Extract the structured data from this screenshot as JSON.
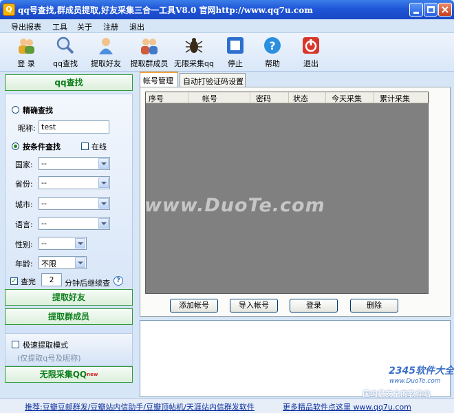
{
  "window": {
    "title": "qq号查找,群成员提取,好友采集三合一工具V8.0 官网http://www.qq7u.com"
  },
  "menu": [
    "导出报表",
    "工具",
    "关于",
    "注册",
    "退出"
  ],
  "toolbar": [
    {
      "label": "登 录",
      "icon": "users-login-icon"
    },
    {
      "label": "qq查找",
      "icon": "magnifier-icon"
    },
    {
      "label": "提取好友",
      "icon": "user-icon"
    },
    {
      "label": "提取群成员",
      "icon": "group-users-icon"
    },
    {
      "label": "无限采集qq",
      "icon": "bug-icon"
    },
    {
      "label": "停止",
      "icon": "stop-icon"
    },
    {
      "label": "帮助",
      "icon": "help-icon"
    },
    {
      "label": "退出",
      "icon": "power-icon"
    }
  ],
  "left": {
    "qq_search_button": "qq查找",
    "exact_search_label": "精确查找",
    "nickname_label": "昵称:",
    "nickname_value": "test",
    "condition_search_label": "按条件查找",
    "online_label": "在线",
    "fields": [
      {
        "label": "国家:",
        "value": "--"
      },
      {
        "label": "省份:",
        "value": "--"
      },
      {
        "label": "城市:",
        "value": "--"
      },
      {
        "label": "语言:",
        "value": "--"
      }
    ],
    "gender_label": "性别:",
    "gender_value": "--",
    "age_label": "年龄:",
    "age_value": "不限",
    "finish_check_label": "查完",
    "minutes_value": "2",
    "minutes_suffix": "分钟后继续查",
    "get_friends_button": "提取好友",
    "get_group_members_button": "提取群成员",
    "fast_mode_label": "极速提取模式",
    "fast_mode_hint": "(仅提取q号及昵称)",
    "unlimited_button": "无限采集QQ",
    "unlimited_badge": "new"
  },
  "tabs": [
    "帐号管理",
    "自动打验证码设置"
  ],
  "grid": {
    "columns": [
      "序号",
      "帐号",
      "密码",
      "状态",
      "今天采集",
      "累计采集"
    ]
  },
  "panel_buttons": [
    "添加帐号",
    "导入帐号",
    "登录",
    "删除"
  ],
  "watermarks": {
    "main": "www.DuoTe.com",
    "site": "2345软件大全",
    "site_url": "www.DuoTe.com",
    "slogan": "国内最安全的软件站"
  },
  "status": {
    "recommend": "推荐:豆瓣豆邮群发/豆瓣站内信助手/豆瓣顶帖机/天涯站内信群发软件",
    "more": "更多精品软件点这里 www.qq7u.com"
  },
  "colors": {
    "title_bar": "#1f56d8",
    "green_text": "#0c7f1a",
    "grid_bg": "#808080",
    "tab_accent": "#f2a33a"
  }
}
